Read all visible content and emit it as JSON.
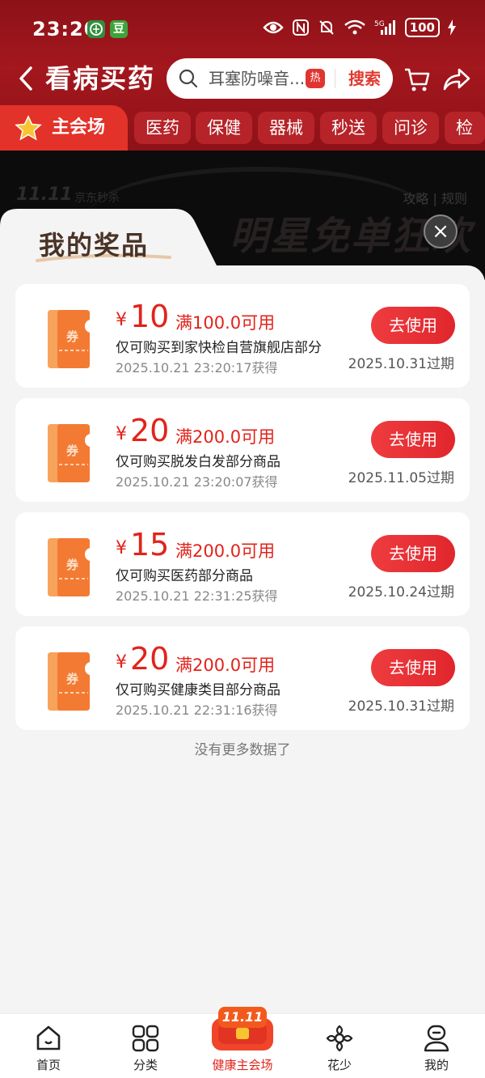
{
  "status_bar": {
    "time": "23:20",
    "app_badge": "豆",
    "battery": "100"
  },
  "nav": {
    "title": "看病买药",
    "search_text": "耳塞防噪音...",
    "hot_badge": "热",
    "search_button": "搜索"
  },
  "tabs": {
    "main": "主会场",
    "items": [
      "医药",
      "保健",
      "器械",
      "秒送",
      "问诊",
      "检护"
    ]
  },
  "banner": {
    "logo": "11.11",
    "sub": "京东秒杀",
    "links": "攻略 | 规则",
    "big_text": "明星免单狂欢"
  },
  "panel": {
    "title": "我的奖品",
    "close_glyph": "×",
    "coupons": [
      {
        "currency": "¥",
        "amount": "10",
        "condition": "满100.0可用",
        "description": "仅可购买到家快检自营旗舰店部分",
        "obtained": "2025.10.21 23:20:17获得",
        "button": "去使用",
        "expiry": "2025.10.31过期"
      },
      {
        "currency": "¥",
        "amount": "20",
        "condition": "满200.0可用",
        "description": "仅可购买脱发白发部分商品",
        "obtained": "2025.10.21 23:20:07获得",
        "button": "去使用",
        "expiry": "2025.11.05过期"
      },
      {
        "currency": "¥",
        "amount": "15",
        "condition": "满200.0可用",
        "description": "仅可购买医药部分商品",
        "obtained": "2025.10.21 22:31:25获得",
        "button": "去使用",
        "expiry": "2025.10.24过期"
      },
      {
        "currency": "¥",
        "amount": "20",
        "condition": "满200.0可用",
        "description": "仅可购买健康类目部分商品",
        "obtained": "2025.10.21 22:31:16获得",
        "button": "去使用",
        "expiry": "2025.10.31过期"
      }
    ],
    "ticket_label": "券",
    "no_more": "没有更多数据了"
  },
  "bottom_nav": {
    "items": [
      "首页",
      "分类",
      "健康主会场",
      "花少",
      "我的"
    ],
    "promo_badge": "11.11",
    "active": "健康主会场"
  },
  "colors": {
    "header_red": "#a3171d",
    "accent_red": "#e2231a",
    "tab_main": "#e3322a"
  }
}
